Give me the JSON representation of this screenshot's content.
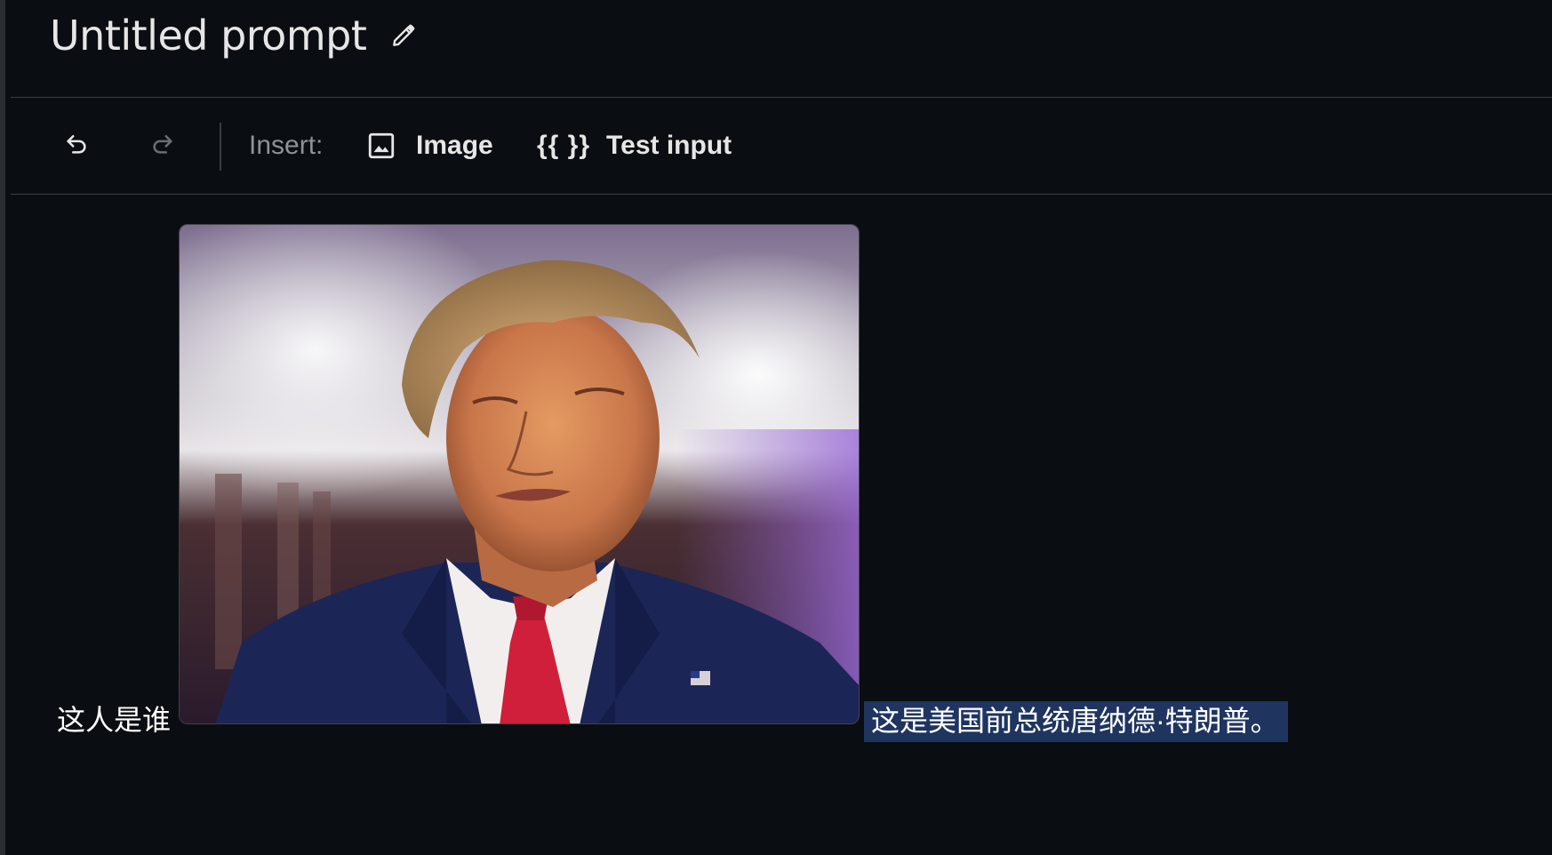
{
  "header": {
    "title": "Untitled prompt"
  },
  "toolbar": {
    "insert_label": "Insert:",
    "image_label": "Image",
    "test_input_braces": "{{ }}",
    "test_input_label": "Test input"
  },
  "conversation": {
    "user_text": "这人是谁",
    "model_text": "这是美国前总统唐纳德·特朗普。",
    "image_icon": "photo-of-man-in-suit"
  },
  "colors": {
    "background": "#0a0d11",
    "selection_highlight": "#1f3560",
    "divider": "#3a3d42",
    "muted_text": "#8e9196"
  }
}
